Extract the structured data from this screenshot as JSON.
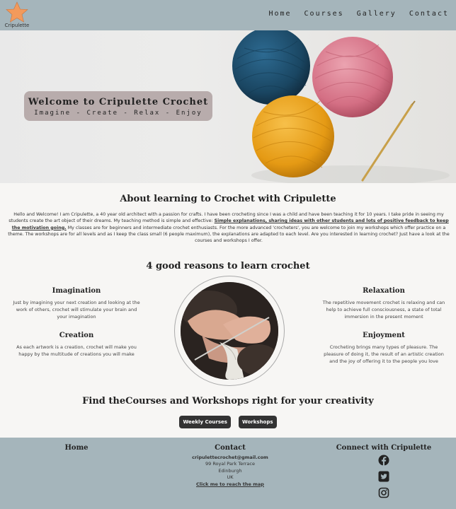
{
  "logo": {
    "label": "Cripulette"
  },
  "nav": {
    "items": [
      "Home",
      "Courses",
      "Gallery",
      "Contact"
    ]
  },
  "hero": {
    "title": "Welcome to Cripulette Crochet",
    "subtitle": "Imagine - Create - Relax - Enjoy"
  },
  "about": {
    "title": "About learning to Crochet with Cripulette",
    "text_1": "Hello and Welcome! I am Cripulette, a 40 year old architect with a passion for crafts. I have been crocheting since I was a child and have been teaching it for 10 years. I take pride in seeing my students create the art object of their dreams. My teaching method is simple and effective: ",
    "highlight": "Simple explanations, sharing ideas with other students and lots of positive feedback to keep the motivation going.",
    "text_2": " My classes are for beginners and intermediate crochet enthusiasts. For the more advanced 'crocheters', you are welcome to join my workshops which offer practice on a theme. The workshops are for all levels and as I keep the class small (6 people maximum), the explanations are adapted to each level. Are you interested in learning crochet? Just have a look at the courses and workshops I offer."
  },
  "reasons": {
    "title": "4 good reasons to learn crochet",
    "items": [
      {
        "title": "Imagination",
        "text": "Just by imagining your next creation and looking at the work of others, crochet will stimulate your brain and your imagination"
      },
      {
        "title": "Relaxation",
        "text": "The repetitive movement crochet is relaxing and can help to achieve full consciousness, a state of total immersion in the present moment"
      },
      {
        "title": "Creation",
        "text": "As each artwork is a creation, crochet will make you happy by the multitude of creations you will make"
      },
      {
        "title": "Enjoyment",
        "text": "Crocheting brings many types of pleasure. The pleasure of doing it, the result of an artistic creation and the joy of offering it to the people you love"
      }
    ]
  },
  "find": {
    "title": "Find theCourses and Workshops right for your creativity",
    "buttons": [
      "Weekly Courses",
      "Workshops"
    ]
  },
  "footer": {
    "home": "Home",
    "contact": {
      "title": "Contact",
      "email": "cripulettecrochet@gmail.com",
      "address": [
        "99 Royal Park Terrace",
        "Edinburgh",
        "UK"
      ],
      "map_link": "Click me to reach the map"
    },
    "connect": {
      "title": "Connect with Cripulette"
    }
  },
  "colors": {
    "nav_bg": "#a5b5bb",
    "button_bg": "#333333",
    "yarn_blue": "#1f4d6e",
    "yarn_pink": "#d9788a",
    "yarn_yellow": "#e8a21a",
    "logo_star": "#f29a5c"
  },
  "icons": {
    "social": [
      "facebook-icon",
      "twitter-icon",
      "instagram-icon"
    ]
  }
}
